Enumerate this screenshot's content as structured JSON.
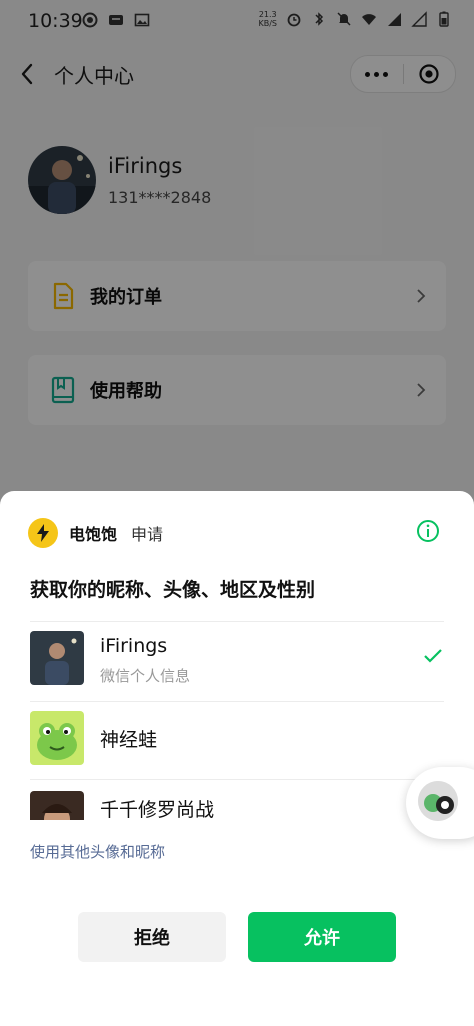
{
  "status_bar": {
    "time": "10:39",
    "net_speed_value": "21.3",
    "net_speed_unit": "KB/S"
  },
  "header": {
    "title": "个人中心"
  },
  "profile": {
    "name": "iFirings",
    "phone": "131****2848"
  },
  "menu": [
    {
      "label": "我的订单",
      "icon": "document-icon"
    },
    {
      "label": "使用帮助",
      "icon": "book-icon"
    }
  ],
  "sheet": {
    "app_name": "电饱饱",
    "apply_label": "申请",
    "request_title": "获取你的昵称、头像、地区及性别",
    "options": [
      {
        "name": "iFirings",
        "sub": "微信个人信息",
        "selected": true
      },
      {
        "name": "神经蛙",
        "sub": "",
        "selected": false
      },
      {
        "name": "千千修罗尚战",
        "sub": "",
        "selected": false
      }
    ],
    "other_link": "使用其他头像和昵称",
    "reject_label": "拒绝",
    "allow_label": "允许"
  },
  "colors": {
    "accent_green": "#07c160",
    "link_blue": "#576b95",
    "logo_yellow": "#f5c518"
  }
}
